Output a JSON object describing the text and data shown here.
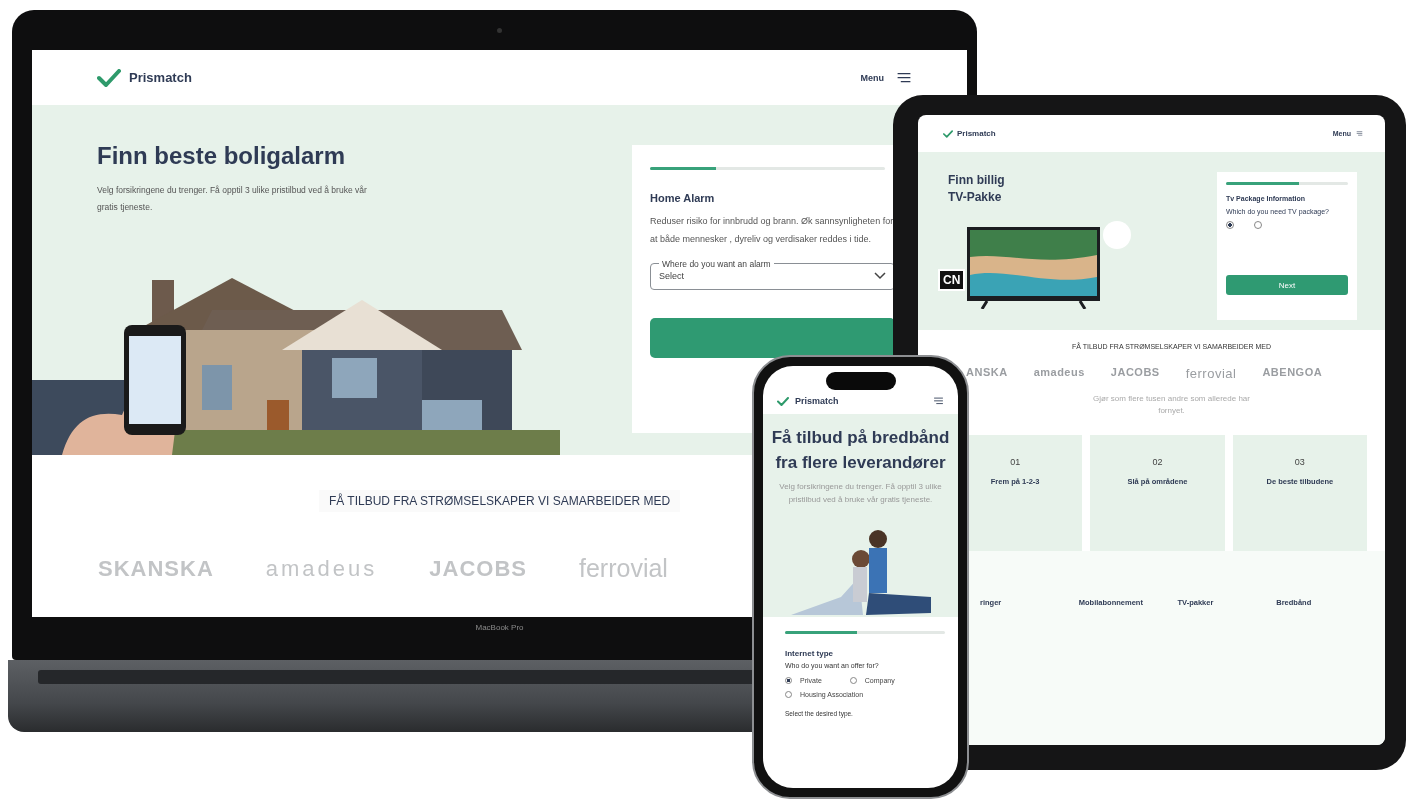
{
  "laptop": {
    "brand_label": "MacBook Pro",
    "header": {
      "logo": "Prismatch",
      "menu": "Menu"
    },
    "hero": {
      "title": "Finn beste boligalarm",
      "subtitle": "Velg forsikringene du trenger. Få opptil 3 ulike pristilbud ved å bruke vår gratis tjeneste."
    },
    "form_card": {
      "progress": {
        "level": 0.28
      },
      "title": "Home Alarm",
      "description": "Reduser risiko for innbrudd og brann. Øk sannsynligheten for at både mennesker , dyreliv og verdisaker reddes i tide.",
      "select": {
        "label": "Where do you want an alarm",
        "value": "Select"
      }
    },
    "partners": {
      "heading": "FÅ TILBUD FRA STRØMSELSKAPER VI SAMARBEIDER MED",
      "logos": [
        "SKANSKA",
        "amadeus",
        "JACOBS",
        "ferrovial"
      ]
    }
  },
  "tablet": {
    "header": {
      "logo": "Prismatch",
      "menu": "Menu"
    },
    "hero": {
      "title_lines": [
        "Finn billig",
        "TV-Pakke"
      ],
      "channel_logo": "CN"
    },
    "form_card": {
      "progress": {
        "level": 0.6
      },
      "title": "Tv Package Information",
      "question": "Which do you need TV package?",
      "options": [
        {
          "selected": true
        },
        {
          "selected": false
        }
      ],
      "button": "Next"
    },
    "partners": {
      "heading": "FÅ TILBUD FRA STRØMSELSKAPER VI SAMARBEIDER MED",
      "logos": [
        "ANSKA",
        "amadeus",
        "JACOBS",
        "ferrovial",
        "ABENGOA"
      ],
      "tagline": "Gjør som flere tusen andre som allerede har fornyet."
    },
    "steps": [
      {
        "number": "01",
        "title": "Frem på 1-2-3"
      },
      {
        "number": "02",
        "title": "Slå på områdene"
      },
      {
        "number": "03",
        "title": "De beste tilbudene"
      }
    ],
    "footer_columns": [
      "ringer",
      "Mobilabonnement",
      "TV-pakker",
      "Bredbånd"
    ]
  },
  "phone": {
    "header": {
      "logo": "Prismatch"
    },
    "hero": {
      "title": "Få tilbud på bredbånd fra flere leverandører",
      "subtitle": "Velg forsikringene du trenger. Få opptil 3 ulike pristilbud ved å bruke vår gratis tjeneste."
    },
    "form": {
      "progress": {
        "level": 0.45
      },
      "title": "Internet type",
      "question": "Who do you want an offer for?",
      "options": [
        {
          "label": "Private",
          "selected": true
        },
        {
          "label": "Company",
          "selected": false
        },
        {
          "label": "Housing Association",
          "selected": false
        }
      ],
      "next_label": "Select the desired type."
    }
  }
}
